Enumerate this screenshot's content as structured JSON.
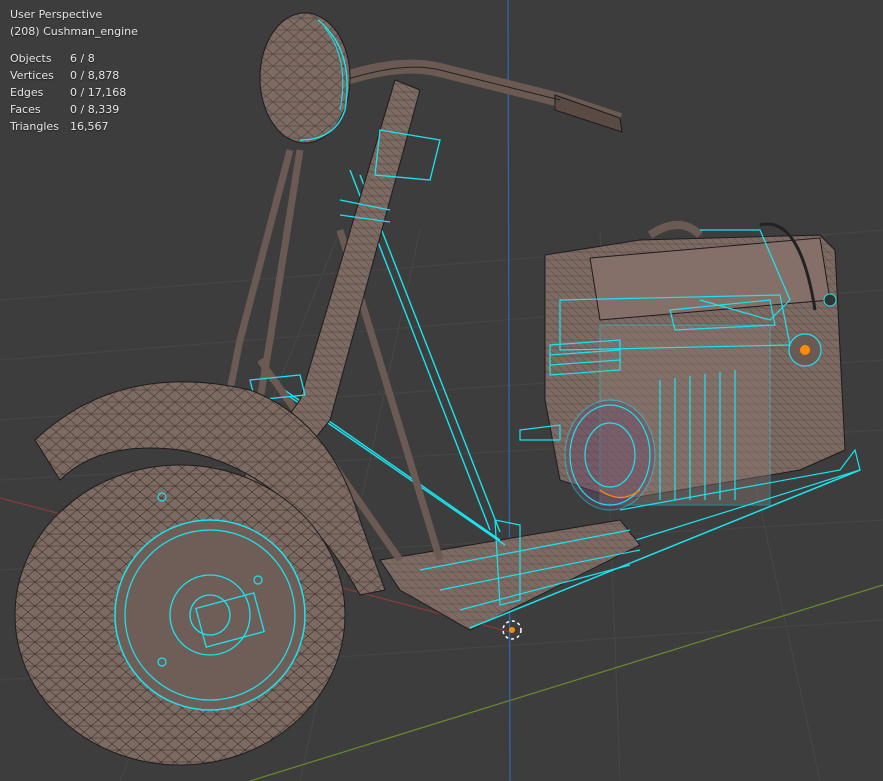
{
  "viewport": {
    "view_name": "User Perspective",
    "object_name": "(208) Cushman_engine",
    "colors": {
      "background": "#3d3d3d",
      "grid": "#4a4a4a",
      "x_axis": "#8b3a3a",
      "y_axis": "#6a8a2a",
      "z_axis": "#2e6bb3",
      "mesh_fill": "#7d6a62",
      "wireframe": "#1c1c1c",
      "selection": "#19e5f0",
      "origin": "#ff8c00"
    }
  },
  "stats": [
    {
      "label": "Objects",
      "value": "6 / 8"
    },
    {
      "label": "Vertices",
      "value": "0 / 8,878"
    },
    {
      "label": "Edges",
      "value": "0 / 17,168"
    },
    {
      "label": "Faces",
      "value": "0 / 8,339"
    },
    {
      "label": "Triangles",
      "value": "16,567"
    }
  ]
}
